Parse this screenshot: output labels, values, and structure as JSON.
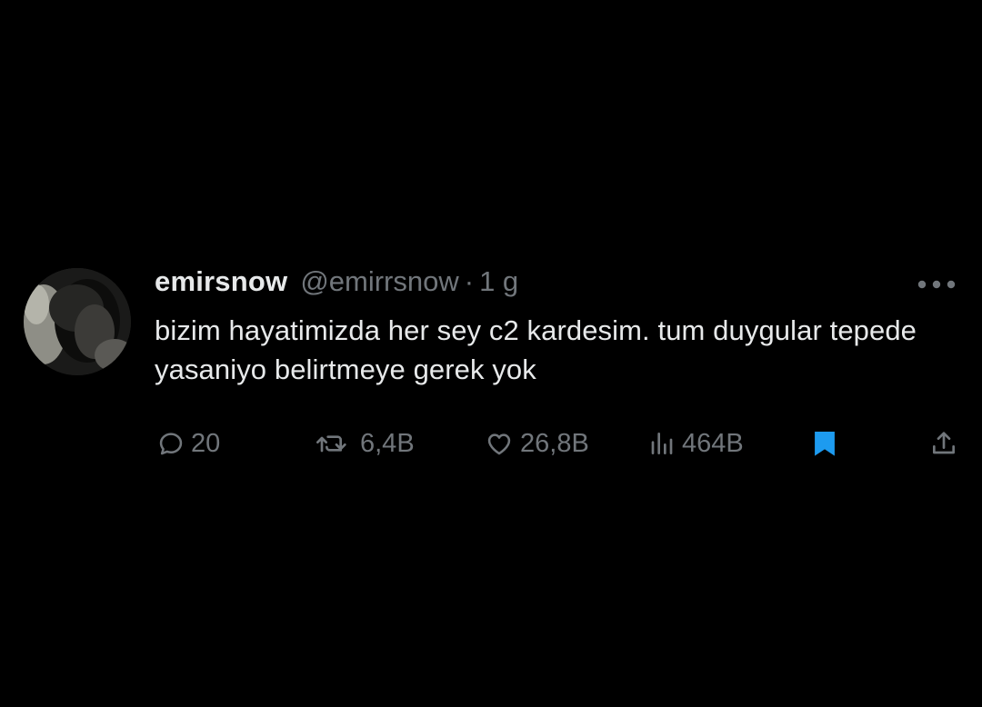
{
  "tweet": {
    "display_name": "emirsnow",
    "handle": "@emirrsnow",
    "separator": "·",
    "time": "1 g",
    "text": "bizim hayatimizda her sey c2 kardesim. tum duygular tepede yasaniyo belirtmeye gerek yok"
  },
  "actions": {
    "reply": {
      "icon": "reply-icon",
      "count": "20"
    },
    "retweet": {
      "icon": "retweet-icon",
      "count": "6,4B"
    },
    "like": {
      "icon": "heart-icon",
      "count": "26,8B"
    },
    "views": {
      "icon": "views-icon",
      "count": "464B"
    },
    "bookmark": {
      "icon": "bookmark-icon",
      "active": true
    },
    "share": {
      "icon": "share-icon"
    },
    "more": {
      "icon": "more-icon"
    }
  },
  "colors": {
    "background": "#000000",
    "text_primary": "#e7e9ea",
    "text_secondary": "#71767b",
    "bookmark_active": "#1d9bf0"
  }
}
